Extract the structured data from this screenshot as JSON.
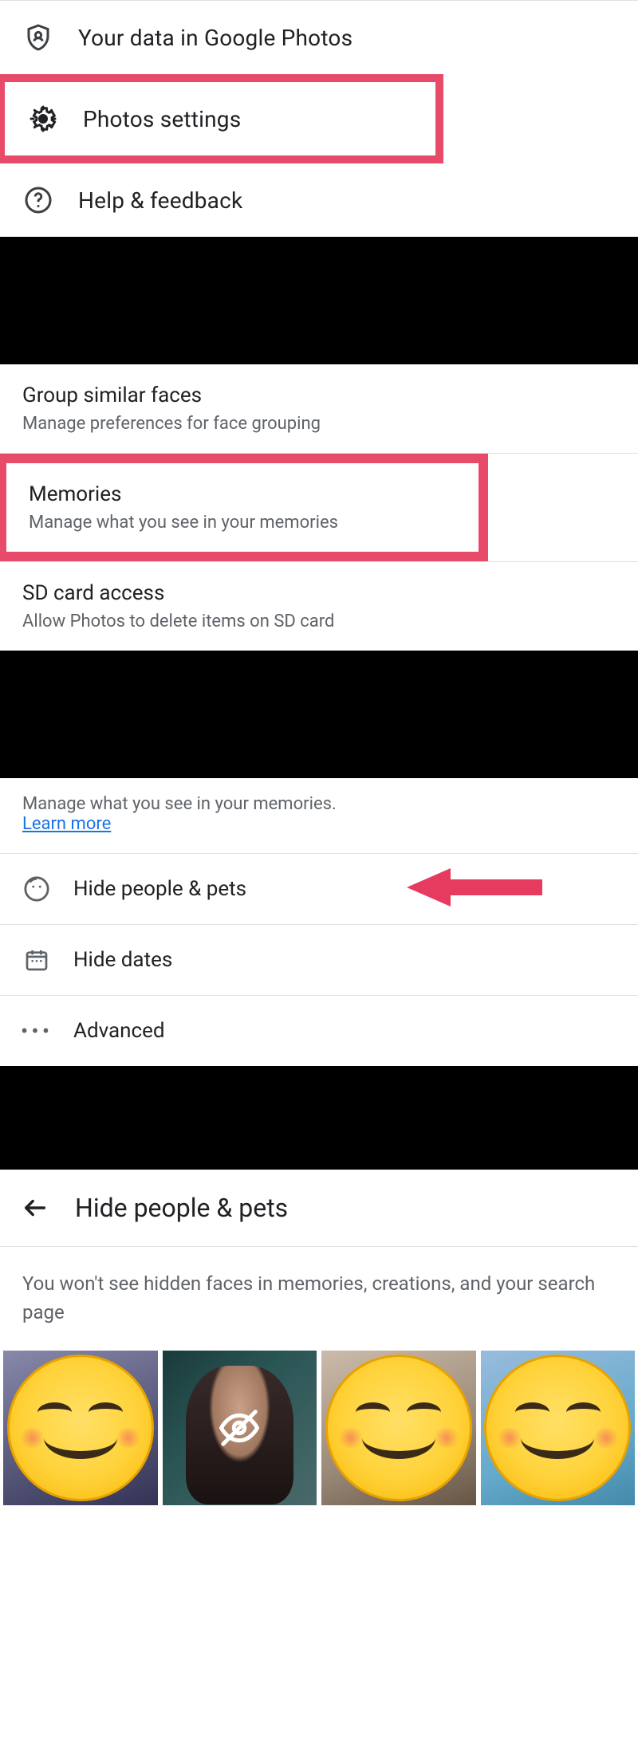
{
  "menu": {
    "data_item": {
      "label": "Your data in Google Photos"
    },
    "settings_item": {
      "label": "Photos settings"
    },
    "help_item": {
      "label": "Help & feedback"
    }
  },
  "settings_list": {
    "faces": {
      "title": "Group similar faces",
      "subtitle": "Manage preferences for face grouping"
    },
    "memories": {
      "title": "Memories",
      "subtitle": "Manage what you see in your memories"
    },
    "sdcard": {
      "title": "SD card access",
      "subtitle": "Allow Photos to delete items on SD card"
    }
  },
  "memories_screen": {
    "description": "Manage what you see in your memories.",
    "learn_more": "Learn more",
    "options": {
      "hide_people": "Hide people & pets",
      "hide_dates": "Hide dates",
      "advanced": "Advanced"
    }
  },
  "hide_people_screen": {
    "title": "Hide people & pets",
    "info": "You won't see hidden faces in memories, creations, and your search page"
  },
  "colors": {
    "highlight": "#e84a6a",
    "link": "#1a73e8"
  }
}
